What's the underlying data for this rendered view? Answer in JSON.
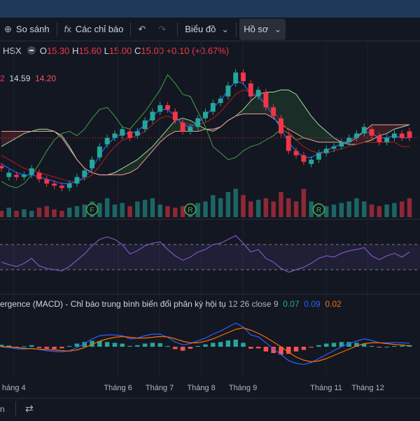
{
  "toolbar": {
    "compare_label": "So sánh",
    "indicators_label": "Các chỉ báo",
    "chart_label": "Biểu đồ",
    "profile_label": "Hồ sơ"
  },
  "legend": {
    "symbol": "HSX",
    "o_label": "O",
    "o_value": "15.30",
    "h_label": "H",
    "h_value": "15.60",
    "l_label": "L",
    "l_value": "15.00",
    "c_label": "C",
    "c_value": "15.00",
    "change": "+0.10 (+0.67%)"
  },
  "ichimoku_values": {
    "v0": "2",
    "v1": "14.59",
    "v2": "14.20"
  },
  "macd_legend": {
    "title": "ergence (MACD) - Chỉ báo trung bình biến đổi phân kỳ hội tụ",
    "params": "12 26 close 9",
    "v_hist": "0.07",
    "v_macd": "0.09",
    "v_signal": "0.02"
  },
  "markers": [
    "F",
    "R",
    "R"
  ],
  "bottom": {
    "left_text": "n"
  },
  "colors": {
    "up": "#26a69a",
    "down": "#f23645",
    "rsi": "#7e57c2",
    "macd": "#2962ff",
    "signal": "#ff6d00"
  },
  "chart_data": [
    {
      "type": "candlestick",
      "x_axis_labels": [
        "háng 4",
        "Tháng 6",
        "Tháng 7",
        "Tháng 8",
        "Tháng 9",
        "Tháng 11",
        "Tháng 12"
      ],
      "x_axis_positions": [
        0.5,
        3,
        4,
        5,
        6,
        8,
        9
      ],
      "x_range": [
        0.2,
        10
      ],
      "y_range": [
        12.0,
        18.5
      ],
      "grid": true,
      "close": [
        13.6,
        13.4,
        13.2,
        13.3,
        13.6,
        13.1,
        12.9,
        12.8,
        12.7,
        12.9,
        13.2,
        13.5,
        14.0,
        14.6,
        15.0,
        15.2,
        15.4,
        15.0,
        15.3,
        15.8,
        16.2,
        16.5,
        16.3,
        15.8,
        15.3,
        15.5,
        15.9,
        16.2,
        16.6,
        16.8,
        17.4,
        18.0,
        17.6,
        16.9,
        17.2,
        16.4,
        16.0,
        15.2,
        14.4,
        14.2,
        13.9,
        14.0,
        14.3,
        14.5,
        14.6,
        14.8,
        15.0,
        15.2,
        15.5,
        15.1,
        14.8,
        15.0,
        15.2,
        15.0,
        15.0
      ],
      "open_offsets": [
        0.1,
        -0.2,
        0.1,
        -0.1,
        -0.3,
        0.3,
        0.2,
        0.1,
        0.1,
        -0.2,
        -0.3,
        -0.3,
        -0.4,
        -0.5,
        -0.3,
        -0.2,
        -0.3,
        0.3,
        -0.2,
        -0.4,
        -0.4,
        -0.3,
        0.2,
        0.4,
        0.4,
        -0.2,
        -0.4,
        -0.3,
        -0.4,
        -0.2,
        -0.5,
        -0.5,
        0.4,
        0.6,
        -0.3,
        0.7,
        0.4,
        0.7,
        0.7,
        0.2,
        0.3,
        -0.2,
        -0.3,
        -0.2,
        -0.1,
        -0.2,
        -0.2,
        -0.2,
        -0.3,
        0.3,
        0.3,
        -0.2,
        -0.2,
        0.2,
        0.3
      ],
      "conversion_line": [
        13.8,
        13.6,
        13.4,
        13.3,
        13.3,
        13.2,
        13.1,
        13.0,
        12.9,
        12.9,
        13.0,
        13.2,
        13.6,
        14.2,
        14.7,
        15.0,
        15.2,
        15.2,
        15.3,
        15.6,
        16.0,
        16.3,
        16.3,
        16.0,
        15.6,
        15.5,
        15.7,
        16.0,
        16.4,
        16.7,
        17.2,
        17.6,
        17.5,
        17.0,
        16.9,
        16.5,
        16.0,
        15.4,
        14.8,
        14.4,
        14.1,
        14.1,
        14.3,
        14.4,
        14.6,
        14.7,
        14.9,
        15.1,
        15.3,
        15.2,
        15.0,
        15.0,
        15.1,
        15.0,
        15.0
      ],
      "base_line": [
        14.2,
        14.0,
        13.8,
        13.6,
        13.5,
        13.4,
        13.3,
        13.2,
        13.1,
        13.0,
        13.0,
        13.1,
        13.3,
        13.7,
        14.2,
        14.6,
        14.9,
        15.0,
        15.1,
        15.3,
        15.6,
        15.9,
        16.0,
        15.9,
        15.7,
        15.6,
        15.6,
        15.7,
        15.9,
        16.2,
        16.6,
        17.0,
        17.2,
        17.1,
        16.9,
        16.6,
        16.2,
        15.8,
        15.3,
        14.9,
        14.6,
        14.4,
        14.3,
        14.3,
        14.4,
        14.5,
        14.6,
        14.7,
        14.8,
        14.8,
        14.8,
        14.8,
        14.8,
        14.6,
        14.6
      ],
      "span_a": [
        14.6,
        14.8,
        15.0,
        15.2,
        15.3,
        15.4,
        15.4,
        15.3,
        15.1,
        14.6,
        14.0,
        13.6,
        13.4,
        13.3,
        13.3,
        13.4,
        13.6,
        13.8,
        14.0,
        14.3,
        14.6,
        15.0,
        15.4,
        15.8,
        15.9,
        15.8,
        15.6,
        15.4,
        15.3,
        15.5,
        15.8,
        16.0,
        16.3,
        16.7,
        17.0,
        17.1,
        17.1,
        17.2,
        17.2,
        17.0,
        16.5,
        16.0,
        15.6,
        15.3,
        15.0,
        14.8,
        14.7,
        14.7,
        14.8,
        14.9,
        15.1,
        15.2,
        15.4,
        15.5,
        15.6
      ],
      "span_b": [
        15.3,
        15.3,
        15.3,
        15.3,
        15.3,
        15.3,
        15.3,
        15.3,
        15.0,
        14.5,
        14.0,
        13.6,
        13.4,
        13.3,
        13.3,
        13.3,
        13.3,
        13.4,
        13.6,
        14.0,
        14.4,
        14.8,
        15.1,
        15.3,
        15.3,
        15.3,
        15.3,
        15.4,
        15.4,
        15.5,
        15.8,
        16.0,
        16.1,
        16.1,
        16.1,
        16.1,
        15.9,
        15.6,
        15.4,
        15.2,
        15.0,
        14.9,
        14.8,
        14.8,
        14.8,
        14.8,
        14.8,
        15.0,
        15.3,
        15.6,
        15.6,
        15.6,
        15.6,
        15.6,
        15.6
      ],
      "lagging_line": [
        13.0,
        12.8,
        12.7,
        12.9,
        13.3,
        13.8,
        14.4,
        14.9,
        15.2,
        15.3,
        15.1,
        15.4,
        15.9,
        16.3,
        16.4,
        16.0,
        15.5,
        15.4,
        15.8,
        16.2,
        16.7,
        17.2,
        17.9,
        17.5,
        17.0,
        16.9,
        16.2,
        15.5,
        14.6,
        14.3,
        14.0,
        14.1,
        14.4,
        14.6,
        14.7,
        14.9,
        15.1,
        15.4,
        15.2,
        14.9,
        15.0
      ],
      "last_price": 15.0,
      "volume": [
        0.2,
        0.3,
        0.2,
        0.25,
        0.2,
        0.3,
        0.35,
        0.25,
        0.2,
        0.3,
        0.35,
        0.4,
        0.5,
        0.45,
        0.6,
        0.4,
        0.45,
        0.35,
        0.5,
        0.55,
        0.6,
        0.4,
        0.35,
        0.3,
        0.35,
        0.4,
        0.45,
        0.5,
        0.7,
        0.6,
        0.8,
        0.9,
        0.7,
        0.5,
        0.55,
        0.6,
        0.5,
        0.8,
        0.6,
        0.5,
        0.9,
        0.5,
        0.4,
        0.35,
        0.4,
        0.45,
        0.5,
        0.6,
        0.5,
        0.4,
        0.35,
        0.4,
        0.45,
        0.5,
        0.6
      ]
    },
    {
      "type": "line",
      "name": "RSI",
      "y_range": [
        0,
        100
      ],
      "bands": [
        30,
        70
      ],
      "values": [
        42,
        38,
        35,
        40,
        48,
        36,
        32,
        30,
        28,
        35,
        45,
        55,
        68,
        78,
        82,
        78,
        70,
        55,
        60,
        68,
        72,
        74,
        62,
        52,
        45,
        50,
        58,
        62,
        70,
        72,
        78,
        84,
        72,
        58,
        62,
        48,
        42,
        32,
        26,
        30,
        34,
        40,
        48,
        52,
        50,
        56,
        60,
        62,
        65,
        52,
        46,
        52,
        56,
        50,
        58
      ]
    },
    {
      "type": "bar",
      "name": "MACD",
      "y_range": [
        -0.8,
        0.8
      ],
      "histogram": [
        0.05,
        0.03,
        -0.02,
        0.01,
        0.04,
        -0.03,
        -0.05,
        -0.06,
        -0.04,
        0.02,
        0.08,
        0.12,
        0.15,
        0.14,
        0.12,
        0.1,
        0.08,
        0.02,
        0.04,
        0.08,
        0.1,
        0.09,
        0.02,
        -0.06,
        -0.1,
        -0.05,
        0.02,
        0.06,
        0.1,
        0.12,
        0.16,
        0.18,
        0.1,
        -0.05,
        -0.04,
        -0.12,
        -0.16,
        -0.2,
        -0.18,
        -0.12,
        -0.08,
        -0.02,
        0.04,
        0.08,
        0.1,
        0.12,
        0.12,
        0.1,
        0.08,
        0.02,
        -0.02,
        0.0,
        0.02,
        0.03,
        0.04
      ],
      "macd_line": [
        0.0,
        -0.02,
        -0.05,
        -0.06,
        -0.04,
        -0.07,
        -0.1,
        -0.12,
        -0.13,
        -0.1,
        -0.02,
        0.08,
        0.2,
        0.28,
        0.3,
        0.3,
        0.28,
        0.2,
        0.22,
        0.28,
        0.32,
        0.32,
        0.24,
        0.12,
        0.05,
        0.08,
        0.15,
        0.22,
        0.32,
        0.4,
        0.5,
        0.6,
        0.5,
        0.3,
        0.25,
        0.1,
        -0.05,
        -0.2,
        -0.35,
        -0.42,
        -0.45,
        -0.4,
        -0.3,
        -0.2,
        -0.1,
        0.0,
        0.08,
        0.14,
        0.2,
        0.16,
        0.1,
        0.1,
        0.11,
        0.1,
        0.09
      ],
      "signal_line": [
        0.0,
        0.0,
        -0.02,
        -0.04,
        -0.05,
        -0.06,
        -0.07,
        -0.08,
        -0.1,
        -0.11,
        -0.08,
        -0.02,
        0.06,
        0.14,
        0.2,
        0.24,
        0.26,
        0.24,
        0.22,
        0.22,
        0.24,
        0.26,
        0.25,
        0.2,
        0.14,
        0.1,
        0.1,
        0.14,
        0.2,
        0.28,
        0.36,
        0.44,
        0.48,
        0.42,
        0.34,
        0.24,
        0.12,
        0.0,
        -0.14,
        -0.26,
        -0.34,
        -0.38,
        -0.36,
        -0.3,
        -0.22,
        -0.14,
        -0.06,
        0.02,
        0.08,
        0.1,
        0.1,
        0.08,
        0.06,
        0.05,
        0.02
      ]
    }
  ]
}
